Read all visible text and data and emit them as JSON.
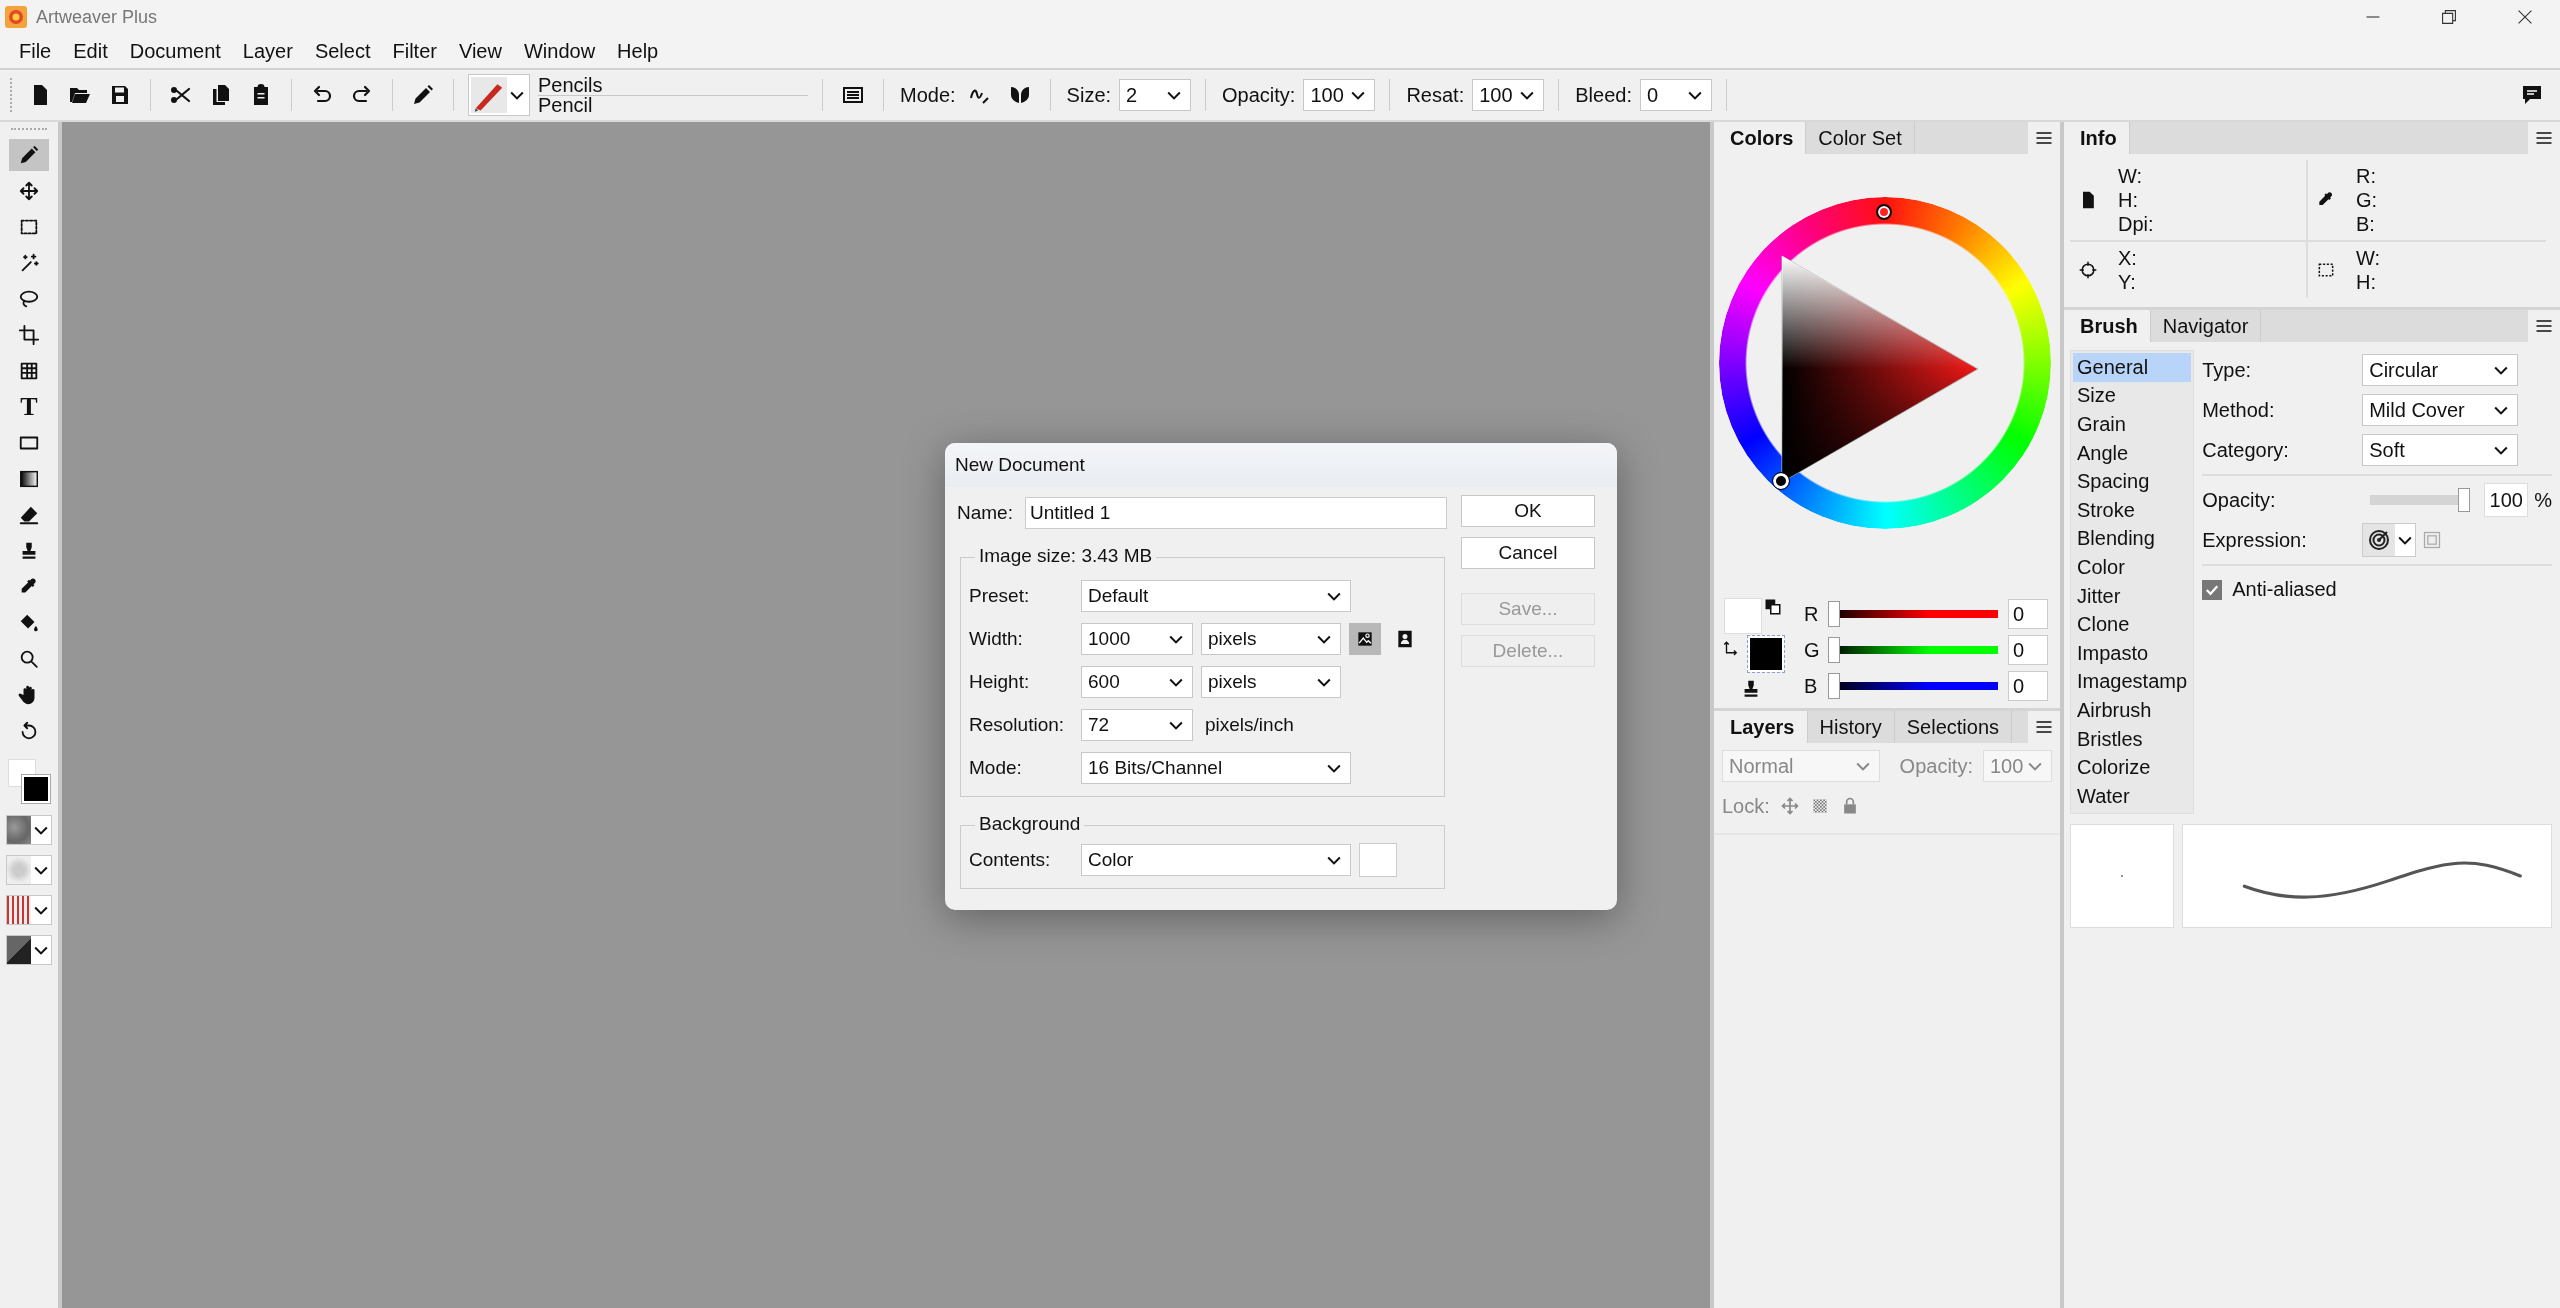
{
  "window": {
    "title": "Artweaver Plus"
  },
  "menu": [
    "File",
    "Edit",
    "Document",
    "Layer",
    "Select",
    "Filter",
    "View",
    "Window",
    "Help"
  ],
  "toolbar": {
    "brush_category": "Pencils",
    "brush_name": "Pencil",
    "mode_label": "Mode:",
    "fields": [
      {
        "label": "Size:",
        "value": "2"
      },
      {
        "label": "Opacity:",
        "value": "100"
      },
      {
        "label": "Resat:",
        "value": "100"
      },
      {
        "label": "Bleed:",
        "value": "0"
      }
    ]
  },
  "tools": [
    {
      "kind": "pencil",
      "selected": true
    },
    {
      "kind": "move",
      "selected": false
    },
    {
      "kind": "rect-select",
      "selected": false
    },
    {
      "kind": "wand",
      "selected": false
    },
    {
      "kind": "lasso",
      "selected": false
    },
    {
      "kind": "crop",
      "selected": false
    },
    {
      "kind": "grid",
      "selected": false
    },
    {
      "kind": "text",
      "glyph": "T",
      "selected": false
    },
    {
      "kind": "shape",
      "selected": false
    },
    {
      "kind": "gradient",
      "selected": false
    },
    {
      "kind": "eraser",
      "selected": false
    },
    {
      "kind": "stamp",
      "selected": false
    },
    {
      "kind": "eyedropper",
      "selected": false
    },
    {
      "kind": "bucket",
      "selected": false
    },
    {
      "kind": "zoom",
      "selected": false
    },
    {
      "kind": "hand",
      "selected": false
    },
    {
      "kind": "rotate",
      "selected": false
    }
  ],
  "dialog": {
    "title": "New Document",
    "name_label": "Name:",
    "name_value": "Untitled 1",
    "size_group": "Image size: 3.43 MB",
    "rows": [
      {
        "kind": "wide",
        "label": "Preset:",
        "value": "Default"
      },
      {
        "kind": "pair",
        "label": "Width:",
        "value": "1000",
        "unit": "pixels",
        "icons": true
      },
      {
        "kind": "pair",
        "label": "Height:",
        "value": "600",
        "unit": "pixels"
      },
      {
        "kind": "unit-text",
        "label": "Resolution:",
        "value": "72",
        "unit": "pixels/inch"
      },
      {
        "kind": "wide",
        "label": "Mode:",
        "value": "16 Bits/Channel"
      }
    ],
    "background_group": "Background",
    "contents_label": "Contents:",
    "contents_value": "Color",
    "buttons": [
      {
        "label": "OK",
        "disabled": false
      },
      {
        "label": "Cancel",
        "disabled": false
      },
      {
        "label": "Save...",
        "disabled": true
      },
      {
        "label": "Delete...",
        "disabled": true
      }
    ]
  },
  "colors_panel": {
    "tabs": [
      {
        "label": "Colors",
        "selected": true
      },
      {
        "label": "Color Set",
        "selected": false
      }
    ],
    "sliders": [
      {
        "label": "R",
        "level": 0,
        "value": "0",
        "color": "#ff0000"
      },
      {
        "label": "G",
        "level": 0,
        "value": "0",
        "color": "#00ff00"
      },
      {
        "label": "B",
        "level": 0,
        "value": "0",
        "color": "#0000ff"
      }
    ]
  },
  "layers_panel": {
    "tabs": [
      {
        "label": "Layers",
        "selected": true
      },
      {
        "label": "History",
        "selected": false
      },
      {
        "label": "Selections",
        "selected": false
      }
    ],
    "blend_mode": "Normal",
    "opacity_label": "Opacity:",
    "opacity": "100",
    "lock_label": "Lock:",
    "disabled": true
  },
  "info_panel": {
    "tab": "Info",
    "groups": [
      {
        "kind": "document",
        "labels": [
          "W:",
          "H:",
          "Dpi:"
        ]
      },
      {
        "kind": "eyedropper",
        "labels": [
          "R:",
          "G:",
          "B:"
        ]
      },
      {
        "kind": "crosshair",
        "labels": [
          "X:",
          "Y:"
        ]
      },
      {
        "kind": "selection",
        "labels": [
          "W:",
          "H:"
        ]
      }
    ]
  },
  "brush_panel": {
    "tabs": [
      {
        "label": "Brush",
        "selected": true
      },
      {
        "label": "Navigator",
        "selected": false
      }
    ],
    "categories": [
      {
        "label": "General",
        "selected": true
      },
      {
        "label": "Size",
        "selected": false
      },
      {
        "label": "Grain",
        "selected": false
      },
      {
        "label": "Angle",
        "selected": false
      },
      {
        "label": "Spacing",
        "selected": false
      },
      {
        "label": "Stroke",
        "selected": false
      },
      {
        "label": "Blending",
        "selected": false
      },
      {
        "label": "Color",
        "selected": false
      },
      {
        "label": "Jitter",
        "selected": false
      },
      {
        "label": "Clone",
        "selected": false
      },
      {
        "label": "Impasto",
        "selected": false
      },
      {
        "label": "Imagestamp",
        "selected": false
      },
      {
        "label": "Airbrush",
        "selected": false
      },
      {
        "label": "Bristles",
        "selected": false
      },
      {
        "label": "Colorize",
        "selected": false
      },
      {
        "label": "Water",
        "selected": false
      }
    ],
    "properties": [
      {
        "label": "Type:",
        "value": "Circular"
      },
      {
        "label": "Method:",
        "value": "Mild Cover"
      },
      {
        "label": "Category:",
        "value": "Soft"
      }
    ],
    "opacity_label": "Opacity:",
    "opacity_slider": {
      "level": 1
    },
    "opacity_value": "100",
    "opacity_unit": "%",
    "expression_label": "Expression:",
    "antialias_label": "Anti-aliased",
    "antialias_checked": true
  }
}
